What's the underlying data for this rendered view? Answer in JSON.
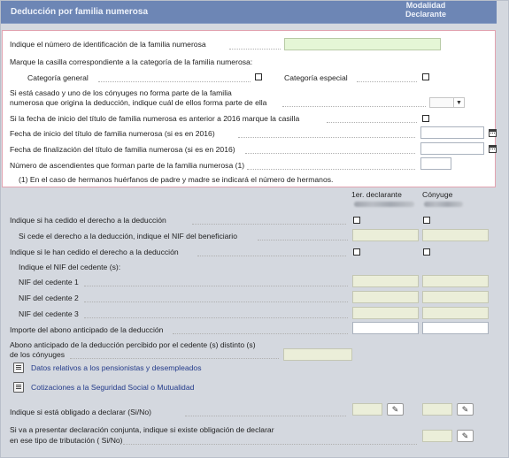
{
  "header": {
    "title": "Deducción por familia numerosa",
    "modalidad_line1": "Modalidad",
    "modalidad_line2": "Declarante"
  },
  "section1": {
    "id_label": "Indique el número de identificación de la familia numerosa",
    "id_value": "",
    "category_prompt": "Marque la casilla correspondiente a la categoría de la familia numerosa:",
    "cat_general": "Categoría general",
    "cat_especial": "Categoría especial",
    "spouse_line1": "Si está casado y uno de los cónyuges no forma parte de la familia",
    "spouse_line2": "numerosa que origina la deducción, indique cuál de ellos forma parte de ella",
    "spouse_select_value": "",
    "before2016_label": "Si la fecha de inicio del título de familia numerosa es anterior a 2016 marque la casilla",
    "start_date_label": "Fecha de inicio del título de familia numerosa (si es en 2016)",
    "end_date_label": "Fecha de finalización del título de familia numerosa (si es en 2016)",
    "ascendants_label": "Número de ascendientes que forman parte de la familia numerosa (1)",
    "footnote": "(1) En el caso de hermanos huérfanos de padre y madre se indicará el número de hermanos."
  },
  "columns": {
    "first": "1er. declarante",
    "second": "Cónyuge"
  },
  "section2": {
    "ceded_label": "Indique si ha cedido el derecho a la deducción",
    "ceded_nif_label": "Si cede el derecho a la deducción, indique el NIF del beneficiario",
    "received_label": "Indique si le han cedido el derecho a la deducción",
    "cedente_prompt": "Indique el NIF del cedente (s):",
    "nif1": "NIF del cedente 1",
    "nif2": "NIF del cedente 2",
    "nif3": "NIF del cedente 3",
    "advance_label": "Importe del abono anticipado de la deducción",
    "advance_other_line1": "Abono anticipado de la deducción percibido por el cedente (s) distinto (s)",
    "advance_other_line2": "de los cónyuges",
    "link_pensionistas": "Datos relativos a los pensionistas y desempleados",
    "link_cotizaciones": "Cotizaciones a la Seguridad Social o Mutualidad",
    "obligado_label": "Indique si está obligado a declarar (Si/No)",
    "conjunta_line1": "Si va a presentar declaración conjunta, indique si existe obligación de declarar",
    "conjunta_line2": "en ese tipo de tributación ( Si/No)"
  },
  "icons": {
    "calendar": "calendar-icon",
    "dropdown": "chevron-down-icon",
    "edit": "pencil-icon",
    "table": "table-icon"
  },
  "colors": {
    "header_bg": "#6d86b5",
    "section_border": "#e2a3b0",
    "green_field": "#e5f6d6",
    "yellow_field": "#ebeed9",
    "link": "#233b8a"
  }
}
